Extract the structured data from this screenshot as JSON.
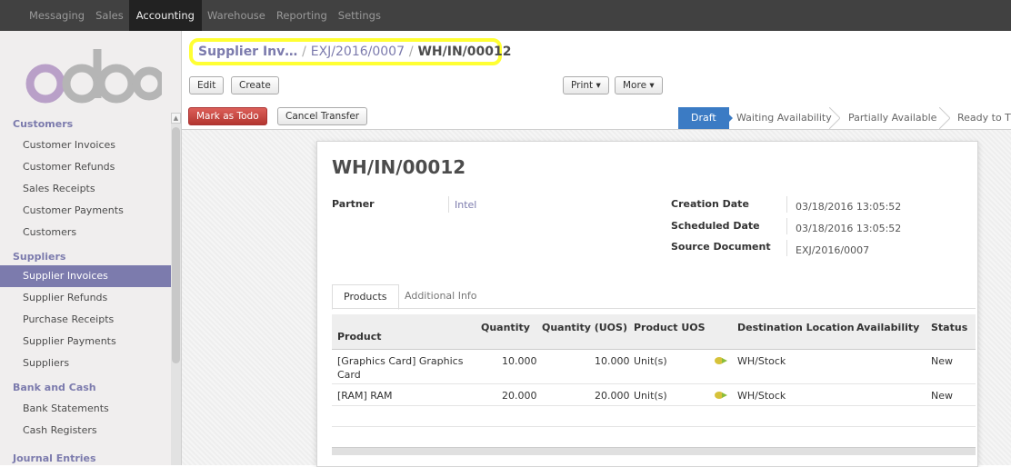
{
  "topbar": {
    "menus": [
      "Messaging",
      "Sales",
      "Accounting",
      "Warehouse",
      "Reporting",
      "Settings"
    ],
    "active": "Accounting"
  },
  "brand": {
    "logo_text": "odoo",
    "logo_color": "#b9a0c8"
  },
  "sidebar": {
    "sections": [
      {
        "title": "Customers",
        "items": [
          "Customer Invoices",
          "Customer Refunds",
          "Sales Receipts",
          "Customer Payments",
          "Customers"
        ]
      },
      {
        "title": "Suppliers",
        "items": [
          "Supplier Invoices",
          "Supplier Refunds",
          "Purchase Receipts",
          "Supplier Payments",
          "Suppliers"
        ]
      },
      {
        "title": "Bank and Cash",
        "items": [
          "Bank Statements",
          "Cash Registers"
        ]
      },
      {
        "title": "Journal Entries",
        "items": []
      }
    ],
    "active_item": "Supplier Invoices"
  },
  "breadcrumb": {
    "first": "Supplier Inv…",
    "sep": "/",
    "second": "EXJ/2016/0007",
    "current": "WH/IN/00012"
  },
  "toolbar": {
    "edit": "Edit",
    "create": "Create",
    "print": "Print ▾",
    "more": "More ▾",
    "mark_todo": "Mark as Todo",
    "cancel_transfer": "Cancel Transfer"
  },
  "statusbar": {
    "steps": [
      "Draft",
      "Waiting Availability",
      "Partially Available",
      "Ready to T"
    ],
    "active": "Draft"
  },
  "record": {
    "title": "WH/IN/00012",
    "partner_label": "Partner",
    "partner": "Intel",
    "creation_date_label": "Creation Date",
    "creation_date": "03/18/2016 13:05:52",
    "scheduled_date_label": "Scheduled Date",
    "scheduled_date": "03/18/2016 13:05:52",
    "source_label": "Source Document",
    "source": "EXJ/2016/0007"
  },
  "tabs": [
    "Products",
    "Additional Info"
  ],
  "table": {
    "headers": [
      "Product",
      "Quantity",
      "Quantity (UOS)",
      "Product UOS",
      "Destination Location",
      "Availability",
      "Status"
    ],
    "rows": [
      {
        "product_line1": "[Graphics Card] Graphics",
        "product_line2": "Card",
        "qty": "10.000",
        "qty_uos": "10.000",
        "uos": "Unit(s)",
        "dest": "WH/Stock",
        "availability": "",
        "status": "New"
      },
      {
        "product_line1": "[RAM] RAM",
        "product_line2": "",
        "qty": "20.000",
        "qty_uos": "20.000",
        "uos": "Unit(s)",
        "dest": "WH/Stock",
        "availability": "",
        "status": "New"
      }
    ]
  },
  "colors": {
    "accent": "#7c7bad",
    "topbar": "#414141",
    "status_active": "#3b7bc4",
    "primary_button": "#c9413b",
    "highlight": "#ffff33"
  }
}
